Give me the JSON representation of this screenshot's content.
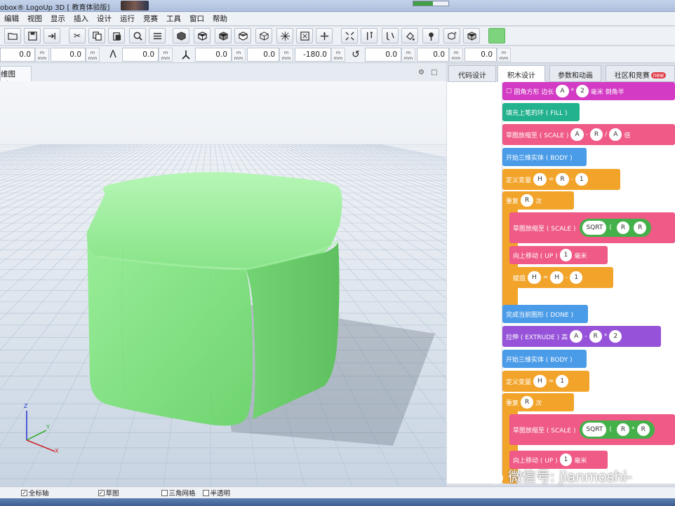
{
  "window": {
    "title": "obox® LogoUp 3D [ 教育体验版]",
    "progress_fraction": 0.55
  },
  "menu": [
    "编辑",
    "视图",
    "显示",
    "插入",
    "设计",
    "运行",
    "竞赛",
    "工具",
    "窗口",
    "帮助"
  ],
  "toolbar": {
    "icons": [
      "open-icon",
      "save-icon",
      "import-icon",
      "cut-icon",
      "copy-icon",
      "paste-icon",
      "find-icon",
      "list-icon",
      "cube-view-icon",
      "cube-front-icon",
      "cube-side-icon",
      "cube-top-icon",
      "cube-wire-icon",
      "cube-iso-icon",
      "frame-icon",
      "axes-icon",
      "fit-icon",
      "distance-icon",
      "measure-icon",
      "paint-icon",
      "pin-icon",
      "cube-edit-icon",
      "cube-solid-icon",
      "color-swatch"
    ],
    "swatch_color": "#7ed47e"
  },
  "numrow": {
    "fields": [
      "0.0",
      "0.0",
      "0.0",
      "0.0",
      "0.0",
      "-180.0",
      "0.0",
      "0.0",
      "0.0"
    ],
    "unit_top": "m",
    "unit_bottom": "mm"
  },
  "left_panel": {
    "tab_label": "维图形"
  },
  "right_panel": {
    "tabs": [
      {
        "label": "代码设计"
      },
      {
        "label": "积木设计"
      },
      {
        "label": "参数和动画"
      },
      {
        "label": "社区和竞赛",
        "badge": "new"
      }
    ],
    "blocks": {
      "b1_label": "圆角方形 边长",
      "b1_a": "A",
      "b1_op": "*",
      "b1_b": "2",
      "b1_tail": "毫米 倒角半",
      "b2": "填充上笔的环 ( FILL )",
      "b3_label": "草图放缩至 ( SCALE )",
      "b3_a": "A",
      "b3_op1": "-",
      "b3_b": "R",
      "b3_op2": "/",
      "b3_c": "A",
      "b3_tail": "倍",
      "b4": "开始三维实体 ( BODY )",
      "b5_label": "定义变量",
      "b5_var": "H",
      "b5_eq": "=",
      "b5_a": "R",
      "b5_op": "-",
      "b5_b": "1",
      "b6_label": "重复",
      "b6_var": "R",
      "b6_tail": "次",
      "b7_label": "草图放缩至 ( SCALE )",
      "b7_fn": "SQRT",
      "b7_paren": "(",
      "b7_a": "R",
      "b7_b": "R",
      "b8_label": "向上移动 ( UP )",
      "b8_val": "1",
      "b8_tail": "毫米",
      "b9_label": "赋值",
      "b9_var": "H",
      "b9_eq": "=",
      "b9_a": "H",
      "b9_op": "-",
      "b9_b": "1",
      "b10": "完成当前图形 ( DONE )",
      "b11_label": "拉伸 ( EXTRUDE ) 高",
      "b11_a": "A",
      "b11_op1": "-",
      "b11_b": "R",
      "b11_op2": "*",
      "b11_c": "2",
      "b12": "开始三维实体 ( BODY )",
      "b13_label": "定义变量",
      "b13_var": "H",
      "b13_eq": "=",
      "b13_val": "1",
      "b14_label": "重复",
      "b14_var": "R",
      "b14_tail": "次",
      "b15_label": "草图放缩至 ( SCALE )",
      "b15_fn": "SQRT",
      "b15_paren": "(",
      "b15_a": "R",
      "b15_op": "*",
      "b15_b": "R",
      "b16_label": "向上移动 ( UP )",
      "b16_val": "1",
      "b16_tail": "毫米"
    },
    "watermark": "微信号: jianmoshi-"
  },
  "statusbar": {
    "items": [
      {
        "label": "全标轴",
        "checked": true
      },
      {
        "label": "草图",
        "checked": true
      },
      {
        "label": "三角网格",
        "checked": false
      },
      {
        "label": "半透明",
        "checked": false
      }
    ]
  },
  "colors": {
    "cube": "#7ee07e",
    "grid": "#a9b9cc",
    "accent_magenta": "#d33bc4",
    "accent_orange": "#f2a42a"
  }
}
